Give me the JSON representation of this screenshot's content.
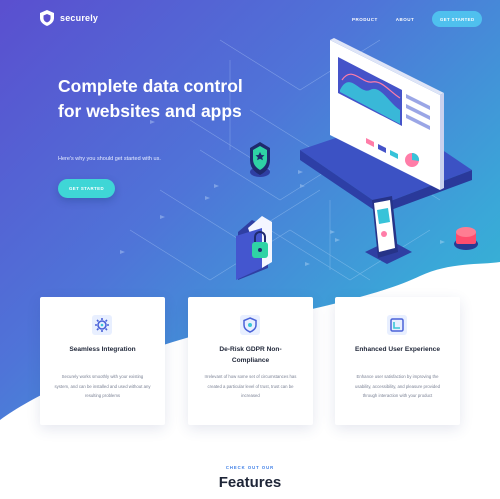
{
  "brand": {
    "name": "securely"
  },
  "nav": {
    "product": "PRODUCT",
    "about": "ABOUT",
    "cta": "GET STARTED"
  },
  "hero": {
    "title": "Complete data control for websites and apps",
    "subtitle": "Here's why you should get started with us.",
    "cta": "GET STARTED"
  },
  "cards": [
    {
      "icon": "gear-icon",
      "title": "Seamless Integration",
      "text": "Securely works smoothly with your existing system, and can be installed and used without any resulting problems"
    },
    {
      "icon": "shield-icon",
      "title": "De-Risk GDPR Non-Compliance",
      "text": "Irrelevant of how some set of circumstances has created a particular level of trust, trust can be increased"
    },
    {
      "icon": "user-experience-icon",
      "title": "Enhanced User Experience",
      "text": "Enhance user satisfaction by improving the usability, accessibility, and pleasure provided through interaction with your product"
    }
  ],
  "features": {
    "eyebrow": "CHECK OUT OUR",
    "title": "Features"
  },
  "colors": {
    "hero_start": "#5a4fcf",
    "hero_end": "#30c2cf",
    "cta": "#3fd6d6",
    "nav_cta": "#4fc0ee",
    "accent_text": "#3a7ce6"
  }
}
